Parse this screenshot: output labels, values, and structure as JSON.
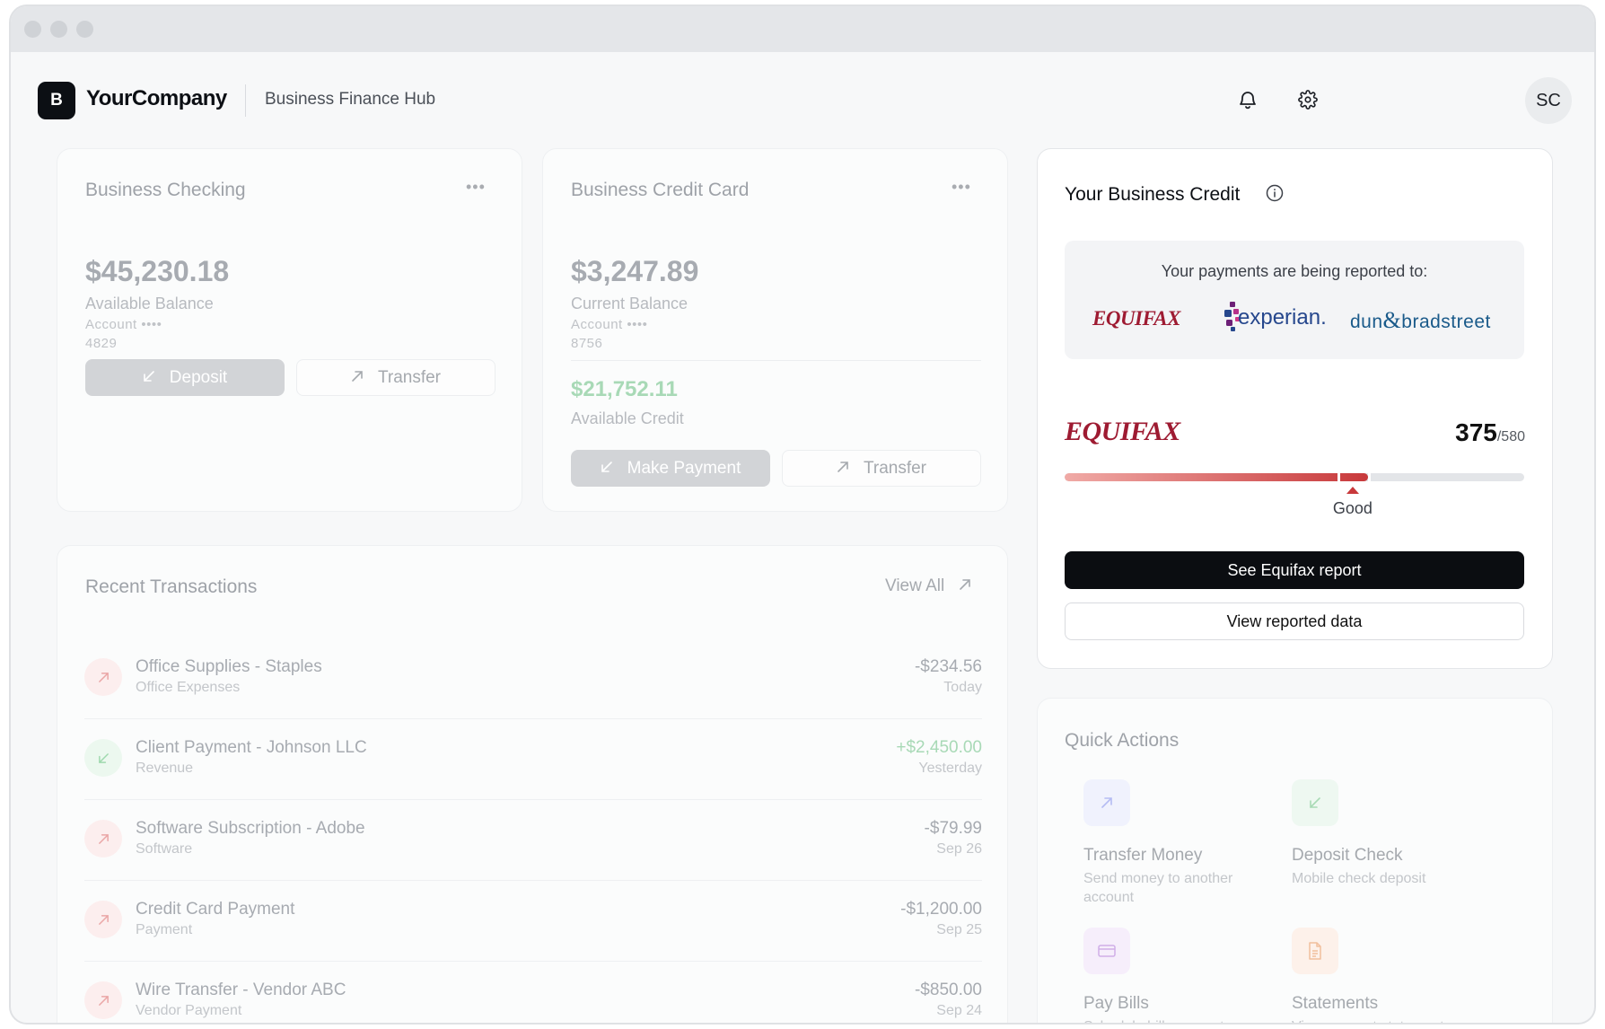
{
  "header": {
    "logo_letter": "B",
    "company": "YourCompany",
    "hub": "Business Finance Hub",
    "avatar": "SC"
  },
  "checking": {
    "title": "Business Checking",
    "more": "•••",
    "balance": "$45,230.18",
    "balance_label": "Available Balance",
    "account_label": "Account ••••",
    "account_last4": "4829",
    "deposit_label": "Deposit",
    "transfer_label": "Transfer"
  },
  "credit_card": {
    "title": "Business Credit Card",
    "more": "•••",
    "balance": "$3,247.89",
    "balance_label": "Current Balance",
    "account_label": "Account ••••",
    "account_last4": "8756",
    "available": "$21,752.11",
    "available_label": "Available Credit",
    "pay_label": "Make Payment",
    "transfer_label": "Transfer"
  },
  "transactions": {
    "title": "Recent Transactions",
    "view_all": "View All",
    "items": [
      {
        "name": "Office Supplies - Staples",
        "category": "Office Expenses",
        "amount": "-$234.56",
        "date": "Today",
        "type": "out"
      },
      {
        "name": "Client Payment - Johnson LLC",
        "category": "Revenue",
        "amount": "+$2,450.00",
        "date": "Yesterday",
        "type": "in"
      },
      {
        "name": "Software Subscription - Adobe",
        "category": "Software",
        "amount": "-$79.99",
        "date": "Sep 26",
        "type": "out"
      },
      {
        "name": "Credit Card Payment",
        "category": "Payment",
        "amount": "-$1,200.00",
        "date": "Sep 25",
        "type": "out"
      },
      {
        "name": "Wire Transfer - Vendor ABC",
        "category": "Vendor Payment",
        "amount": "-$850.00",
        "date": "Sep 24",
        "type": "out"
      }
    ]
  },
  "credit": {
    "title": "Your Business Credit",
    "reported_to": "Your payments are being reported to:",
    "bureaus": {
      "equifax": "EQUIFAX",
      "experian": "experian.",
      "dnb_left": "dun",
      "dnb_amp": "&",
      "dnb_right": "bradstreet"
    },
    "score_provider": "EQUIFAX",
    "score": "375",
    "score_max": "/580",
    "score_fraction": 0.66,
    "rating": "Good",
    "primary_btn": "See Equifax report",
    "secondary_btn": "View reported data"
  },
  "quick_actions": {
    "title": "Quick Actions",
    "items": [
      {
        "title": "Transfer Money",
        "desc": "Send money to another account",
        "icon": "arrow-up-right-icon"
      },
      {
        "title": "Deposit Check",
        "desc": "Mobile check deposit",
        "icon": "arrow-down-left-icon"
      },
      {
        "title": "Pay Bills",
        "desc": "Schedule bill payments",
        "icon": "card-icon"
      },
      {
        "title": "Statements",
        "desc": "View account statements",
        "icon": "document-icon"
      }
    ]
  },
  "colors": {
    "equifax_red": "#9e1b32",
    "experian_blue": "#26478d",
    "experian_purple": "#6d2077",
    "dnb_blue": "#1a5a8a",
    "outgoing_bg": "#fceeee",
    "incoming_bg": "#ecf8ef"
  }
}
